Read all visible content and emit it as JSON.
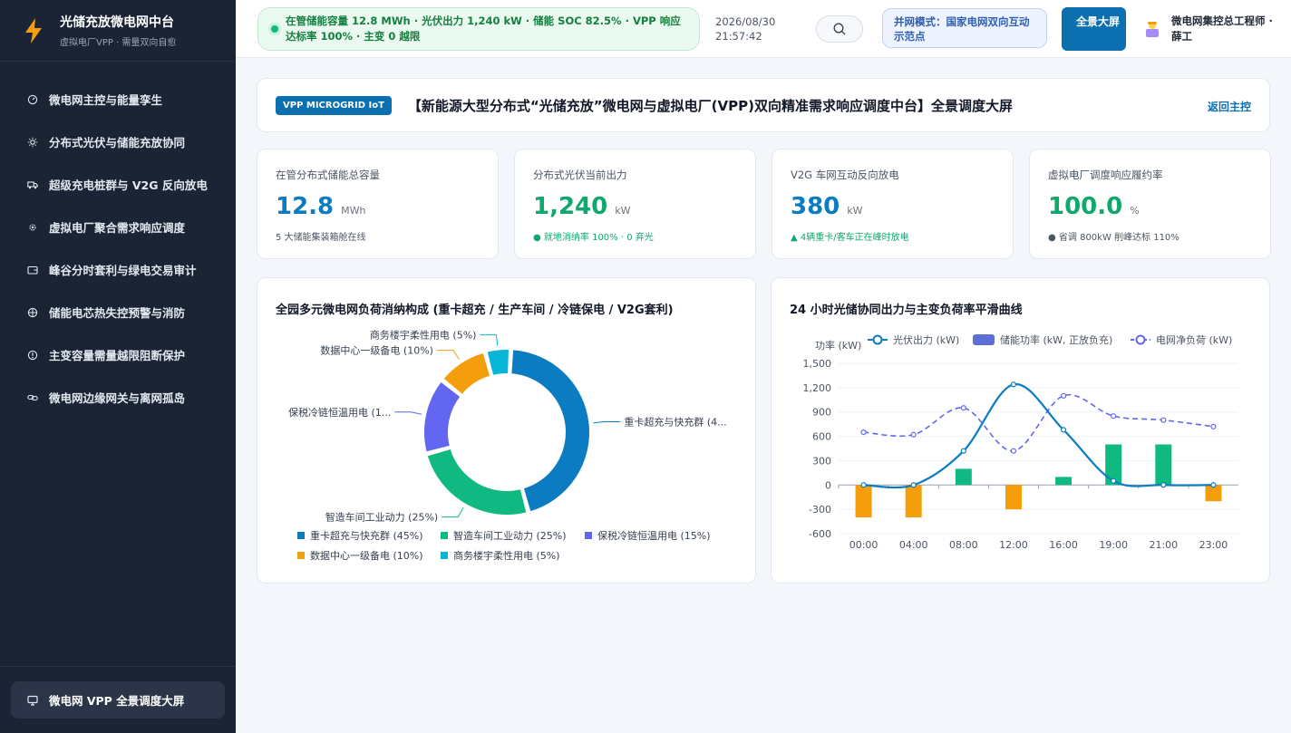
{
  "brand": {
    "title": "光储充放微电网中台",
    "subtitle": "虚拟电厂VPP · 需量双向自愈"
  },
  "sidebar": {
    "items": [
      {
        "label": "微电网主控与能量孪生",
        "icon": "gauge-icon"
      },
      {
        "label": "分布式光伏与储能充放协同",
        "icon": "sun-icon"
      },
      {
        "label": "超级充电桩群与 V2G 反向放电",
        "icon": "truck-icon"
      },
      {
        "label": "虚拟电厂聚合需求响应调度",
        "icon": "gear-icon"
      },
      {
        "label": "峰谷分时套利与绿电交易审计",
        "icon": "wallet-icon"
      },
      {
        "label": "储能电芯热失控预警与消防",
        "icon": "target-icon"
      },
      {
        "label": "主变容量需量越限阻断保护",
        "icon": "alert-icon"
      },
      {
        "label": "微电网边缘网关与离网孤岛",
        "icon": "link-icon"
      }
    ],
    "active": {
      "label": "微电网 VPP 全景调度大屏",
      "icon": "monitor-icon"
    }
  },
  "header": {
    "status": "在管储能容量 12.8 MWh · 光伏出力 1,240 kW · 储能 SOC 82.5% · VPP 响应达标率 100% · 主变 0 越限",
    "date": "2026/08/30",
    "time": "21:57:42",
    "grid_mode": "并网模式：国家电网双向互动示范点",
    "fullscreen_label": "全景大屏",
    "user": "微电网集控总工程师 · 薛工"
  },
  "banner": {
    "badge": "VPP MICROGRID IoT",
    "title": "【新能源大型分布式“光储充放”微电网与虚拟电厂(VPP)双向精准需求响应调度中台】全景调度大屏",
    "back": "返回主控"
  },
  "kpis": [
    {
      "label": "在管分布式储能总容量",
      "value": "12.8",
      "unit": "MWh",
      "note": "5 大储能集装箱舱在线",
      "color": "#0b7cc1",
      "note_color": "#4b5563"
    },
    {
      "label": "分布式光伏当前出力",
      "value": "1,240",
      "unit": "kW",
      "note": "● 就地消纳率 100% · 0 弃光",
      "color": "#10a86d",
      "note_color": "#10a86d"
    },
    {
      "label": "V2G 车网互动反向放电",
      "value": "380",
      "unit": "kW",
      "note": "▲ 4辆重卡/客车正在峰时放电",
      "color": "#0b7cc1",
      "note_color": "#10a86d"
    },
    {
      "label": "虚拟电厂调度响应履约率",
      "value": "100.0",
      "unit": "%",
      "note": "● 省调 800kW 削峰达标 110%",
      "color": "#10a86d",
      "note_color": "#4b5563"
    }
  ],
  "chart_data": [
    {
      "type": "pie",
      "title": "全园多元微电网负荷消纳构成 (重卡超充 / 生产车间 / 冷链保电 / V2G套利)",
      "categories": [
        "重卡超充与快充群",
        "智造车间工业动力",
        "保税冷链恒温用电",
        "数据中心一级备电",
        "商务楼宇柔性用电"
      ],
      "values": [
        45,
        25,
        15,
        10,
        5
      ],
      "slice_labels": [
        "重卡超充与快充群 (4...",
        "智造车间工业动力 (25%)",
        "保税冷链恒温用电 (1...",
        "数据中心一级备电 (10%)",
        "商务楼宇柔性用电 (5%)"
      ],
      "legend_labels": [
        "重卡超充与快充群 (45%)",
        "智造车间工业动力 (25%)",
        "保税冷链恒温用电 (15%)",
        "数据中心一级备电 (10%)",
        "商务楼宇柔性用电 (5%)"
      ],
      "colors": [
        "#0b7cc1",
        "#10b981",
        "#6366f1",
        "#f59e0b",
        "#06b6d4"
      ]
    },
    {
      "type": "line",
      "title": "24 小时光储协同出力与主变负荷率平滑曲线",
      "ylabel": "功率 (kW)",
      "ylim": [
        -600,
        1500
      ],
      "yticks": [
        "1,500",
        "1,200",
        "900",
        "600",
        "300",
        "0",
        "-300",
        "-600"
      ],
      "ytick_values": [
        1500,
        1200,
        900,
        600,
        300,
        0,
        -300,
        -600
      ],
      "categories": [
        "00:00",
        "04:00",
        "08:00",
        "12:00",
        "16:00",
        "19:00",
        "21:00",
        "23:00"
      ],
      "series": [
        {
          "name": "光伏出力 (kW)",
          "kind": "line",
          "color": "#0b7cc1",
          "values": [
            0,
            0,
            420,
            1240,
            680,
            50,
            0,
            0
          ]
        },
        {
          "name": "储能功率 (kW, 正放负充)",
          "kind": "bar",
          "color": "#5b6fd6",
          "values": [
            -400,
            -400,
            200,
            -300,
            100,
            500,
            500,
            -200
          ]
        },
        {
          "name": "电网净负荷 (kW)",
          "kind": "dashed",
          "color": "#6366f1",
          "values": [
            650,
            620,
            950,
            420,
            1100,
            850,
            800,
            720
          ]
        }
      ],
      "bar_pos_color": "#10b981",
      "bar_neg_color": "#f59e0b"
    }
  ]
}
